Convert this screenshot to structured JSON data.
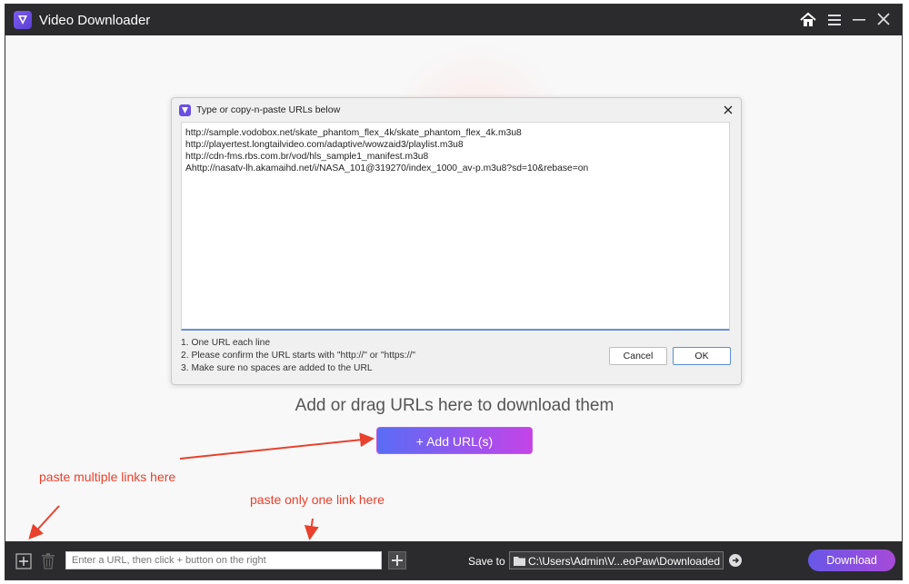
{
  "window": {
    "title": "Video Downloader"
  },
  "dialog": {
    "title": "Type or copy-n-paste URLs below",
    "urls_text": "http://sample.vodobox.net/skate_phantom_flex_4k/skate_phantom_flex_4k.m3u8\nhttp://playertest.longtailvideo.com/adaptive/wowzaid3/playlist.m3u8\nhttp://cdn-fms.rbs.com.br/vod/hls_sample1_manifest.m3u8\nAhttp://nasatv-lh.akamaihd.net/i/NASA_101@319270/index_1000_av-p.m3u8?sd=10&rebase=on",
    "hints": [
      "1. One URL each line",
      "2. Please confirm the URL starts with \"http://\" or \"https://\"",
      "3. Make sure no spaces are added to the URL"
    ],
    "cancel_label": "Cancel",
    "ok_label": "OK"
  },
  "main": {
    "drag_text": "Add or drag URLs here to download them",
    "add_url_label": "+ Add URL(s)"
  },
  "annotations": {
    "multiple": "paste multiple links here",
    "single": "paste only one link here"
  },
  "bottom": {
    "url_placeholder": "Enter a URL, then click + button on the right",
    "save_to_label": "Save to",
    "save_path": "C:\\Users\\Admin\\V...eoPaw\\Downloaded",
    "download_label": "Download"
  },
  "icons": [
    "app-logo-icon",
    "home-icon",
    "menu-icon",
    "minimize-icon",
    "close-icon",
    "plus-icon",
    "trash-icon",
    "folder-icon",
    "arrow-right-icon"
  ],
  "colors": {
    "accent_red": "#e8412d",
    "titlebar": "#2b2b2e",
    "gradient_start": "#5a6cf5",
    "gradient_end": "#c444e8"
  }
}
